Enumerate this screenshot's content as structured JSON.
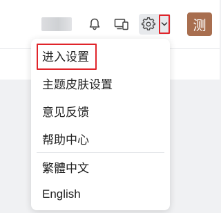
{
  "header": {
    "icons": {
      "notifications": "bell-icon",
      "devices": "devices-icon",
      "settings": "gear-icon",
      "dropdown": "chevron-down-icon"
    },
    "avatar_text": "测",
    "avatar_color": "#a86e4f",
    "highlight_color": "#e0242a"
  },
  "menu": {
    "items_group1": [
      {
        "label": "进入设置"
      },
      {
        "label": "主题皮肤设置"
      },
      {
        "label": "意见反馈"
      },
      {
        "label": "帮助中心"
      }
    ],
    "items_group2": [
      {
        "label": "繁體中文"
      },
      {
        "label": "English"
      }
    ]
  }
}
